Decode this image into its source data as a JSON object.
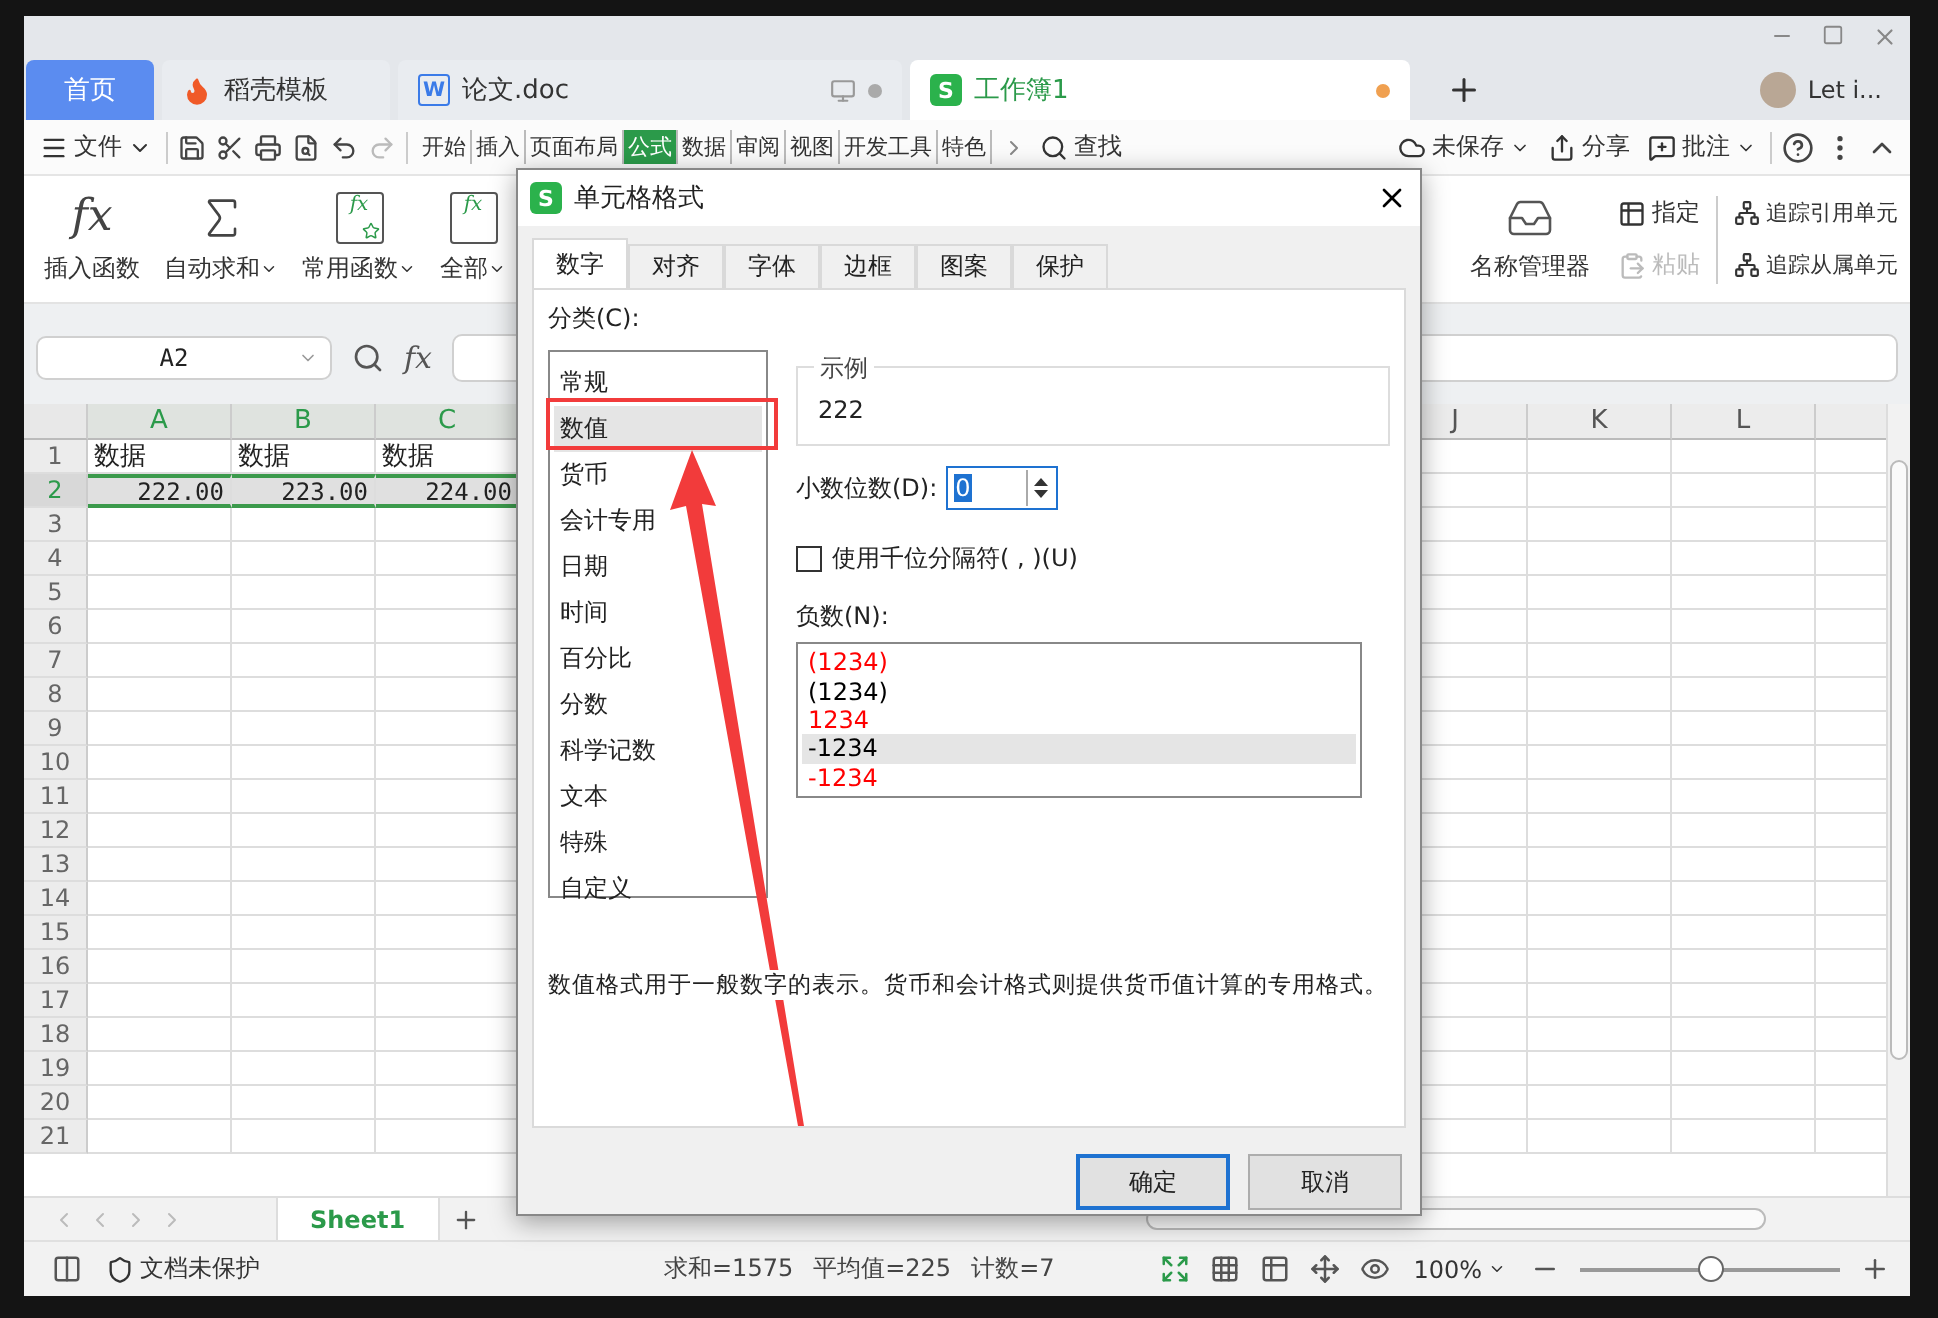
{
  "tabs": [
    {
      "label": "首页",
      "kind": "home",
      "selected": false
    },
    {
      "label": "稻壳模板",
      "kind": "docer",
      "selected": false
    },
    {
      "label": "论文.doc",
      "kind": "writer",
      "icon_text": "W",
      "selected": false
    },
    {
      "label": "工作簿1",
      "kind": "sheet",
      "icon_text": "S",
      "selected": true
    }
  ],
  "account": {
    "name": "Let i..."
  },
  "menu": {
    "file": "文件",
    "tabs": [
      {
        "label": "开始",
        "selected": false
      },
      {
        "label": "插入",
        "selected": false
      },
      {
        "label": "页面布局",
        "selected": false
      },
      {
        "label": "公式",
        "selected": true
      },
      {
        "label": "数据",
        "selected": false
      },
      {
        "label": "审阅",
        "selected": false
      },
      {
        "label": "视图",
        "selected": false
      },
      {
        "label": "开发工具",
        "selected": false
      },
      {
        "label": "特色",
        "selected": false
      }
    ],
    "find": "查找",
    "save_state": "未保存",
    "share": "分享",
    "comment": "批注"
  },
  "ribbon": {
    "left": [
      {
        "label": "插入函数",
        "kind": "fx",
        "glyph": "fx",
        "dropdown": false
      },
      {
        "label": "自动求和",
        "kind": "sigma",
        "dropdown": true
      },
      {
        "label": "常用函数",
        "kind": "fxstar",
        "glyph": "fx",
        "dropdown": true
      },
      {
        "label": "全部",
        "kind": "fxbox",
        "glyph": "fx",
        "dropdown": true
      }
    ],
    "name_manager": "名称管理器",
    "small": [
      {
        "label": "指定",
        "disabled": false
      },
      {
        "label": "粘贴",
        "disabled": true
      }
    ],
    "trace": [
      "追踪引用单元",
      "追踪从属单元"
    ]
  },
  "formula_bar": {
    "name_box": "A2",
    "fx": "fx"
  },
  "grid": {
    "columns": [
      {
        "label": "A",
        "selected": true
      },
      {
        "label": "B",
        "selected": true
      },
      {
        "label": "C",
        "selected": true
      },
      {
        "label": "J",
        "selected": false
      },
      {
        "label": "K",
        "selected": false
      },
      {
        "label": "L",
        "selected": false
      }
    ],
    "rows": [
      {
        "number": "1",
        "selected": false,
        "cells": [
          "数据",
          "数据",
          "数据"
        ]
      },
      {
        "number": "2",
        "selected": true,
        "cells": [
          "222.00",
          "223.00",
          "224.00"
        ]
      },
      {
        "number": "3",
        "selected": false,
        "cells": []
      },
      {
        "number": "4",
        "selected": false,
        "cells": []
      },
      {
        "number": "5",
        "selected": false,
        "cells": []
      },
      {
        "number": "6",
        "selected": false,
        "cells": []
      },
      {
        "number": "7",
        "selected": false,
        "cells": []
      },
      {
        "number": "8",
        "selected": false,
        "cells": []
      },
      {
        "number": "9",
        "selected": false,
        "cells": []
      },
      {
        "number": "10",
        "selected": false,
        "cells": []
      },
      {
        "number": "11",
        "selected": false,
        "cells": []
      },
      {
        "number": "12",
        "selected": false,
        "cells": []
      },
      {
        "number": "13",
        "selected": false,
        "cells": []
      },
      {
        "number": "14",
        "selected": false,
        "cells": []
      },
      {
        "number": "15",
        "selected": false,
        "cells": []
      },
      {
        "number": "16",
        "selected": false,
        "cells": []
      },
      {
        "number": "17",
        "selected": false,
        "cells": []
      },
      {
        "number": "18",
        "selected": false,
        "cells": []
      },
      {
        "number": "19",
        "selected": false,
        "cells": []
      },
      {
        "number": "20",
        "selected": false,
        "cells": []
      },
      {
        "number": "21",
        "selected": false,
        "cells": []
      }
    ]
  },
  "sheet_tabs": [
    {
      "label": "Sheet1",
      "selected": true
    }
  ],
  "status_bar": {
    "protection": "文档未保护",
    "stats": [
      "求和=1575",
      "平均值=225",
      "计数=7"
    ],
    "zoom": "100%",
    "zoom_slider": {
      "level": 0.5
    }
  },
  "dialog": {
    "title": "单元格格式",
    "icon_text": "S",
    "tabs": [
      {
        "label": "数字",
        "selected": true
      },
      {
        "label": "对齐",
        "selected": false
      },
      {
        "label": "字体",
        "selected": false
      },
      {
        "label": "边框",
        "selected": false
      },
      {
        "label": "图案",
        "selected": false
      },
      {
        "label": "保护",
        "selected": false
      }
    ],
    "category_label": "分类(C):",
    "categories": [
      {
        "label": "常规",
        "selected": false
      },
      {
        "label": "数值",
        "selected": true
      },
      {
        "label": "货币",
        "selected": false
      },
      {
        "label": "会计专用",
        "selected": false
      },
      {
        "label": "日期",
        "selected": false
      },
      {
        "label": "时间",
        "selected": false
      },
      {
        "label": "百分比",
        "selected": false
      },
      {
        "label": "分数",
        "selected": false
      },
      {
        "label": "科学记数",
        "selected": false
      },
      {
        "label": "文本",
        "selected": false
      },
      {
        "label": "特殊",
        "selected": false
      },
      {
        "label": "自定义",
        "selected": false
      }
    ],
    "sample_label": "示例",
    "sample_value": "222",
    "decimals_label": "小数位数(D):",
    "decimals_value": "0",
    "thousands": {
      "label": "使用千位分隔符( , )(U)",
      "checked": false
    },
    "negative_label": "负数(N):",
    "negatives": [
      {
        "text": "(1234)",
        "color": "#ff0000",
        "selected": false
      },
      {
        "text": "(1234)",
        "color": "#000000",
        "selected": false
      },
      {
        "text": "1234",
        "color": "#ff0000",
        "selected": false
      },
      {
        "text": "-1234",
        "color": "#000000",
        "selected": true
      },
      {
        "text": "-1234",
        "color": "#ff0000",
        "selected": false
      }
    ],
    "description": "数值格式用于一般数字的表示。货币和会计格式则提供货币值计算的专用格式。",
    "buttons": [
      {
        "label": "确定",
        "kind": "default"
      },
      {
        "label": "取消",
        "kind": "normal"
      }
    ]
  }
}
